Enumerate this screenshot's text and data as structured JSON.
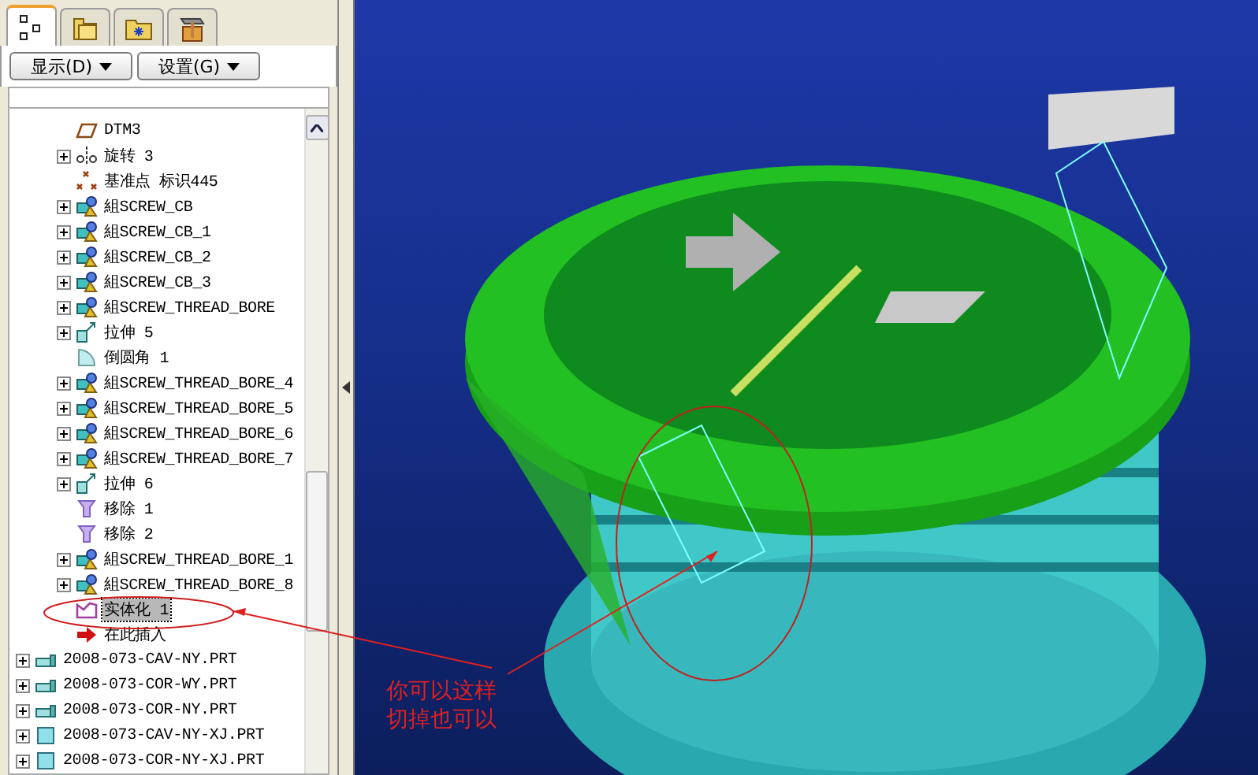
{
  "panel_tabs": [
    {
      "kind": "tree",
      "selected": true
    },
    {
      "kind": "folders",
      "selected": false
    },
    {
      "kind": "favorites",
      "selected": false
    },
    {
      "kind": "tools",
      "selected": false
    }
  ],
  "panel_buttons": [
    {
      "label": "显示(D)"
    },
    {
      "label": "设置(G)"
    }
  ],
  "tree": {
    "features": [
      {
        "label": "DTM3",
        "kind": "plane",
        "expandable": false,
        "selected": false
      },
      {
        "label": "旋转 3",
        "kind": "revolve",
        "expandable": true,
        "selected": false
      },
      {
        "label": "基准点 标识445",
        "kind": "point",
        "expandable": false,
        "selected": false
      },
      {
        "label": "組SCREW_CB",
        "kind": "group",
        "expandable": true,
        "selected": false
      },
      {
        "label": "組SCREW_CB_1",
        "kind": "group",
        "expandable": true,
        "selected": false
      },
      {
        "label": "組SCREW_CB_2",
        "kind": "group",
        "expandable": true,
        "selected": false
      },
      {
        "label": "組SCREW_CB_3",
        "kind": "group",
        "expandable": true,
        "selected": false
      },
      {
        "label": "組SCREW_THREAD_BORE",
        "kind": "group",
        "expandable": true,
        "selected": false
      },
      {
        "label": "拉伸 5",
        "kind": "extrude",
        "expandable": true,
        "selected": false
      },
      {
        "label": "倒圆角 1",
        "kind": "round",
        "expandable": false,
        "selected": false
      },
      {
        "label": "組SCREW_THREAD_BORE_4",
        "kind": "group",
        "expandable": true,
        "selected": false
      },
      {
        "label": "組SCREW_THREAD_BORE_5",
        "kind": "group",
        "expandable": true,
        "selected": false
      },
      {
        "label": "組SCREW_THREAD_BORE_6",
        "kind": "group",
        "expandable": true,
        "selected": false
      },
      {
        "label": "組SCREW_THREAD_BORE_7",
        "kind": "group",
        "expandable": true,
        "selected": false
      },
      {
        "label": "拉伸 6",
        "kind": "extrude",
        "expandable": true,
        "selected": false
      },
      {
        "label": "移除 1",
        "kind": "remove",
        "expandable": false,
        "selected": false
      },
      {
        "label": "移除 2",
        "kind": "remove",
        "expandable": false,
        "selected": false
      },
      {
        "label": "組SCREW_THREAD_BORE_1",
        "kind": "group",
        "expandable": true,
        "selected": false
      },
      {
        "label": "組SCREW_THREAD_BORE_8",
        "kind": "group",
        "expandable": true,
        "selected": false
      },
      {
        "label": "实体化 1",
        "kind": "solidify",
        "expandable": false,
        "selected": true
      },
      {
        "label": "在此插入",
        "kind": "insert",
        "expandable": false,
        "selected": false
      }
    ],
    "parts": [
      {
        "label": "2008-073-CAV-NY.PRT",
        "kind": "part",
        "expandable": true,
        "selected": false
      },
      {
        "label": "2008-073-COR-WY.PRT",
        "kind": "part",
        "expandable": true,
        "selected": false
      },
      {
        "label": "2008-073-COR-NY.PRT",
        "kind": "part",
        "expandable": true,
        "selected": false
      },
      {
        "label": "2008-073-CAV-NY-XJ.PRT",
        "kind": "block",
        "expandable": true,
        "selected": false
      },
      {
        "label": "2008-073-COR-NY-XJ.PRT",
        "kind": "block",
        "expandable": true,
        "selected": false
      }
    ]
  },
  "annotation": {
    "lines": [
      "你可以这样",
      "切掉也可以"
    ]
  }
}
